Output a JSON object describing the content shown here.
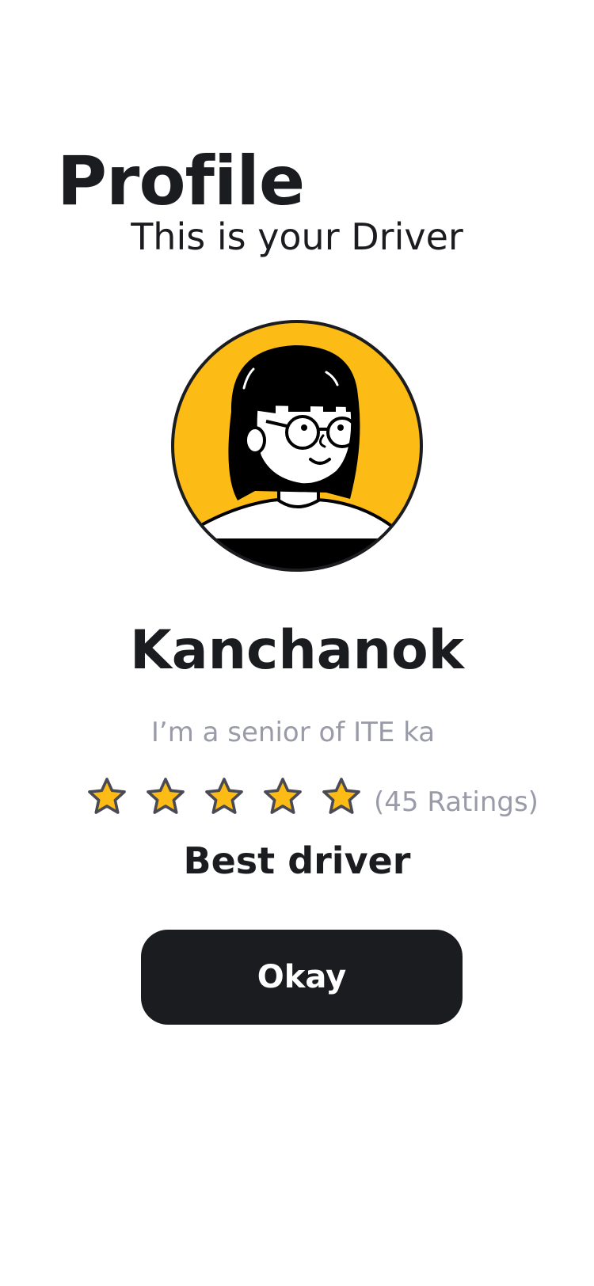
{
  "page": {
    "title": "Profile",
    "subtitle": "This is your Driver"
  },
  "driver": {
    "name": "Kanchanok",
    "bio": "I’m a senior of ITE ka",
    "rating": {
      "stars_filled": 5,
      "stars_total": 5,
      "count_label": "(45 Ratings)"
    },
    "badge": "Best driver",
    "avatar_icon": "woman-with-glasses-avatar-icon"
  },
  "actions": {
    "okay_label": "Okay"
  },
  "colors": {
    "avatar_bg": "#fdbb15",
    "star_fill": "#fdbb15",
    "star_stroke": "#4a4a55",
    "button_bg": "#1b1c20",
    "muted_text": "#9a9ba8"
  }
}
